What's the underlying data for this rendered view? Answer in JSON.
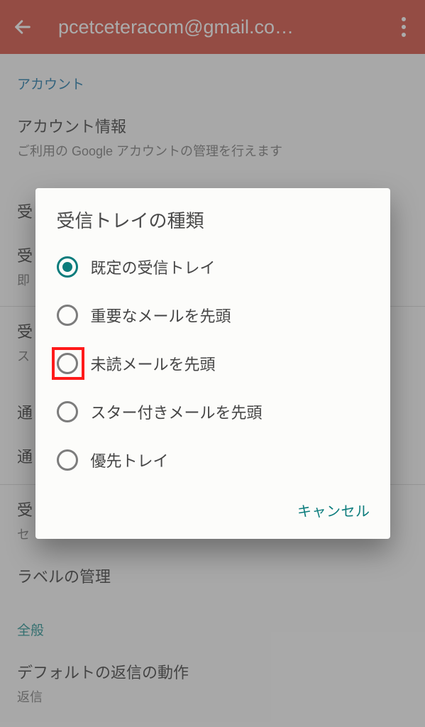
{
  "header": {
    "title": "pcetceteracom@gmail.co…"
  },
  "sections": {
    "account_label": "アカウント",
    "account_info": {
      "title": "アカウント情報",
      "subtitle": "ご利用の Google アカウントの管理を行えます"
    },
    "inbox_row1_prefix": "受",
    "inbox_row2": {
      "prefix": "受",
      "sub_prefix": "即"
    },
    "inbox_row3": {
      "prefix": "受",
      "sub_prefix": "ス"
    },
    "notify1_prefix": "通",
    "notify2_prefix": "通",
    "download": {
      "prefix": "受",
      "sub_prefix": "セ"
    },
    "label_mgmt": "ラベルの管理",
    "general_label": "全般",
    "reply_action": {
      "title": "デフォルトの返信の動作",
      "subtitle": "返信"
    }
  },
  "dialog": {
    "title": "受信トレイの種類",
    "options": [
      {
        "label": "既定の受信トレイ",
        "selected": true,
        "highlighted": false
      },
      {
        "label": "重要なメールを先頭",
        "selected": false,
        "highlighted": false
      },
      {
        "label": "未読メールを先頭",
        "selected": false,
        "highlighted": true
      },
      {
        "label": "スター付きメールを先頭",
        "selected": false,
        "highlighted": false
      },
      {
        "label": "優先トレイ",
        "selected": false,
        "highlighted": false
      }
    ],
    "cancel": "キャンセル"
  }
}
